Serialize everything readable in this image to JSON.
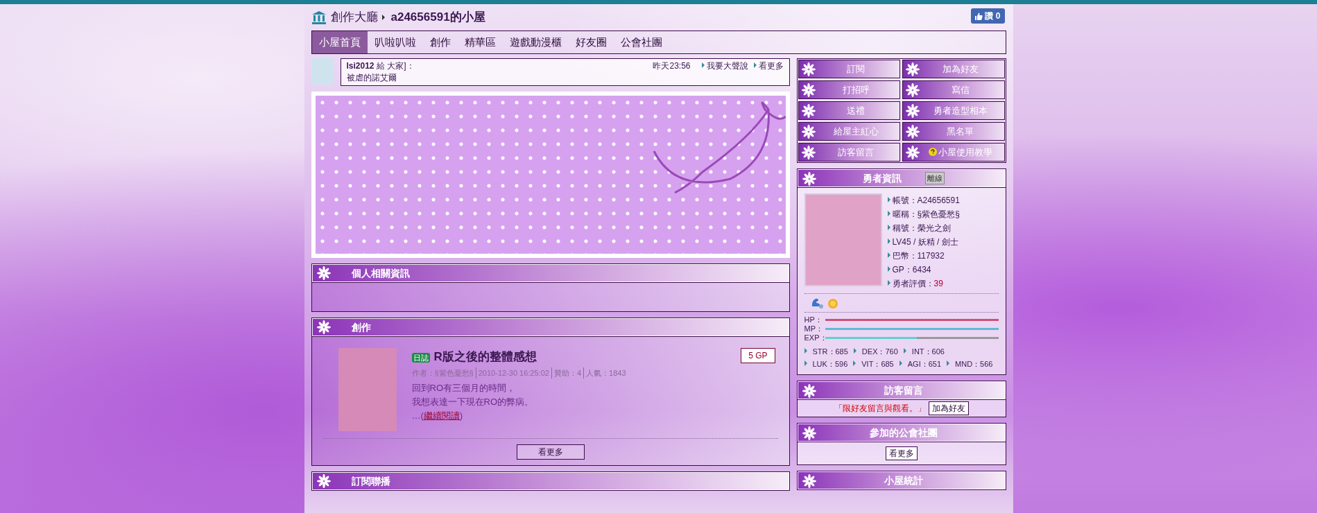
{
  "header": {
    "breadcrumb": [
      "創作大廳",
      "a24656591的小屋"
    ],
    "like": {
      "label": "讚",
      "count": "0"
    }
  },
  "nav": [
    {
      "label": "小屋首頁",
      "selected": true
    },
    {
      "label": "叭啦叭啦",
      "selected": false
    },
    {
      "label": "創作",
      "selected": false
    },
    {
      "label": "精華區",
      "selected": false
    },
    {
      "label": "遊戲動漫櫃",
      "selected": false
    },
    {
      "label": "好友圈",
      "selected": false
    },
    {
      "label": "公會社團",
      "selected": false
    }
  ],
  "shout": {
    "user": "lsi2012",
    "to": "給 大家]：",
    "message": "被虐的諾艾爾",
    "time": "昨天23:56",
    "links": [
      "我要大聲說",
      "看更多"
    ]
  },
  "personal": {
    "title": "個人相關資訊"
  },
  "creation": {
    "title": "創作",
    "post": {
      "tag": "日誌",
      "title": "R版之後的整體感想",
      "gp": "5 GP",
      "meta": [
        "作者：§紫色憂愁§",
        "2010-12-30 16:25:02",
        "贊助：4",
        "人氣：1843"
      ],
      "lines": [
        "回到RO有三個月的時間，",
        "我想表達一下現在RO的弊病。"
      ],
      "read_more_prefix": "…(",
      "read_more": "繼續閱讀",
      "read_more_suffix": ")"
    },
    "more": "看更多"
  },
  "subscribe": {
    "title": "訂閱聯播"
  },
  "actions": [
    {
      "label": "訂閱",
      "kind": "plain"
    },
    {
      "label": "加為好友",
      "kind": "plain"
    },
    {
      "label": "打招呼",
      "kind": "plain"
    },
    {
      "label": "寫信",
      "kind": "plain"
    },
    {
      "label": "送禮",
      "kind": "plain"
    },
    {
      "label": "勇者造型相本",
      "kind": "plain"
    },
    {
      "label": "給屋主紅心",
      "kind": "plain"
    },
    {
      "label": "黑名單",
      "kind": "plain"
    },
    {
      "label": "訪客留言",
      "kind": "plain"
    },
    {
      "label": "小屋使用教學",
      "kind": "help"
    }
  ],
  "hero": {
    "title": "勇者資訊",
    "status": "離線",
    "fields": [
      {
        "text": "帳號：A24656591",
        "kind": "plain"
      },
      {
        "text": "暱稱：§紫色憂愁§",
        "kind": "plain"
      },
      {
        "text": "稱號：榮光之劍",
        "kind": "plain"
      },
      {
        "text": "LV45 / 妖精 / 劍士",
        "kind": "plain"
      },
      {
        "text": "巴幣：117932",
        "kind": "plain"
      },
      {
        "text": "GP：6434",
        "kind": "plain"
      },
      {
        "text": "勇者評價：",
        "value": "39",
        "kind": "rating"
      }
    ],
    "bars": [
      {
        "label": "HP：",
        "kind": "hp",
        "level": 1
      },
      {
        "label": "MP：",
        "kind": "mp",
        "level": 1
      },
      {
        "label": "EXP：",
        "kind": "exp",
        "level": 0.53
      }
    ],
    "stats": [
      "STR：685",
      "DEX：760",
      "INT：606",
      "LUK：596",
      "VIT：685",
      "AGI：651",
      "MND：566"
    ]
  },
  "visitor": {
    "title": "訪客留言",
    "notice": "「限好友留言與觀看。」",
    "button": "加為好友"
  },
  "guild": {
    "title": "參加的公會社團",
    "button": "看更多"
  },
  "house_stats": {
    "title": "小屋統計"
  }
}
